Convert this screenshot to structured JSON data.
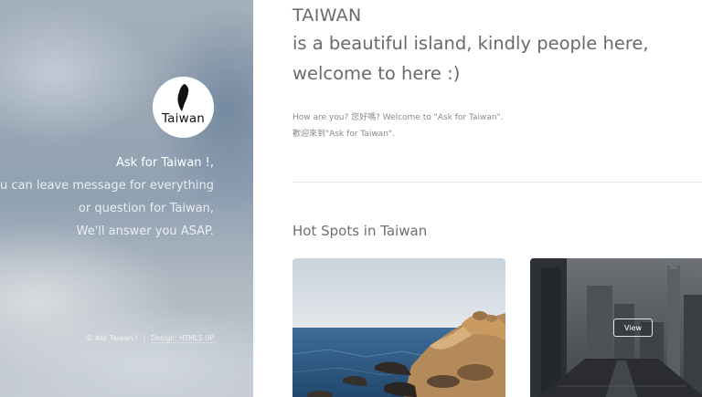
{
  "sidebar": {
    "avatar_label": "Taiwan",
    "intro_lines": [
      "Ask for Taiwan !,",
      "you can leave message for everything",
      "or question for Taiwan,",
      "We'll answer you ASAP."
    ],
    "footer": {
      "copyright": "© Ask Taiwan !",
      "separator": "|",
      "design_credit": "Design: HTML5 UP"
    }
  },
  "main": {
    "title": "TAIWAN",
    "subtitle": "is a beautiful island, kindly people here, welcome to here :)",
    "greeting_lines": [
      "How are you? 您好嗎? Welcome to \"Ask for Taiwan\".",
      "歡迎來到\"Ask for Taiwan\"."
    ],
    "section_title": "Hot Spots in Taiwan",
    "cards": [
      {
        "image": "coast-rocks-photo"
      },
      {
        "image": "city-skyline-photo",
        "button_label": "View"
      }
    ]
  },
  "colors": {
    "text_gray": "#6a6a6a",
    "muted_gray": "#8a8a8a",
    "rule": "#e8e8e8"
  }
}
